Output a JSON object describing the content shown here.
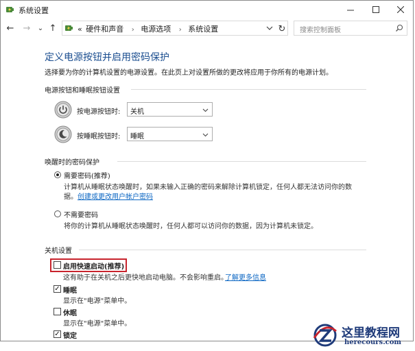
{
  "window": {
    "title": "系统设置"
  },
  "nav": {
    "back": "←",
    "forward": "→",
    "recent": "⌄",
    "up": "↑",
    "breadcrumb_prefix": "«",
    "breadcrumbs": [
      "硬件和声音",
      "电源选项",
      "系统设置"
    ],
    "breadcrumb_sep": "›",
    "refresh": "↻",
    "search_placeholder": "搜索控制面板"
  },
  "page": {
    "title": "定义电源按钮并启用密码保护",
    "description": "选择要为你的计算机设置的电源设置。在此页上对设置所做的更改将应用于你所有的电源计划。"
  },
  "power_buttons": {
    "header": "电源按钮和睡眠按钮设置",
    "power_label": "按电源按钮时:",
    "power_value": "关机",
    "sleep_label": "按睡眠按钮时:",
    "sleep_value": "睡眠"
  },
  "password": {
    "header": "唤醒时的密码保护",
    "require_label": "需要密码(推荐)",
    "require_desc_1": "计算机从睡眠状态唤醒时，如果未输入正确的密码来解除计算机锁定，任何人都无法访问你的数",
    "require_desc_2": "据。",
    "require_link": "创建或更改用户帐户密码",
    "require_checked": true,
    "norequire_label": "不需要密码",
    "norequire_desc": "将你的计算机从睡眠状态唤醒时，任何人都可以访问你的数据，因为计算机未锁定。",
    "norequire_checked": false
  },
  "shutdown": {
    "header": "关机设置",
    "fast_label": "启用快速启动(推荐)",
    "fast_desc": "这有助于在关机之后更快地启动电脑。不会影响重启。",
    "fast_link": "了解更多信息",
    "fast_checked": false,
    "sleep_label": "睡眠",
    "sleep_desc": "显示在\"电源\"菜单中。",
    "sleep_checked": true,
    "hibernate_label": "休眠",
    "hibernate_desc": "显示在\"电源\"菜单中。",
    "hibernate_checked": false,
    "lock_label": "锁定",
    "lock_checked": true,
    "check_mark": "✓"
  },
  "watermark": {
    "cn": "这里教程网",
    "en": "herecours.com"
  },
  "colors": {
    "title_blue": "#1a4d8f",
    "link_blue": "#0b66c3",
    "highlight_red": "#c8232c",
    "watermark_navy": "#1f3b7a"
  },
  "icons": {
    "title": "power-options-icon",
    "address": "control-panel-icon",
    "power_button": "power-button-icon",
    "sleep_button": "sleep-button-icon"
  }
}
